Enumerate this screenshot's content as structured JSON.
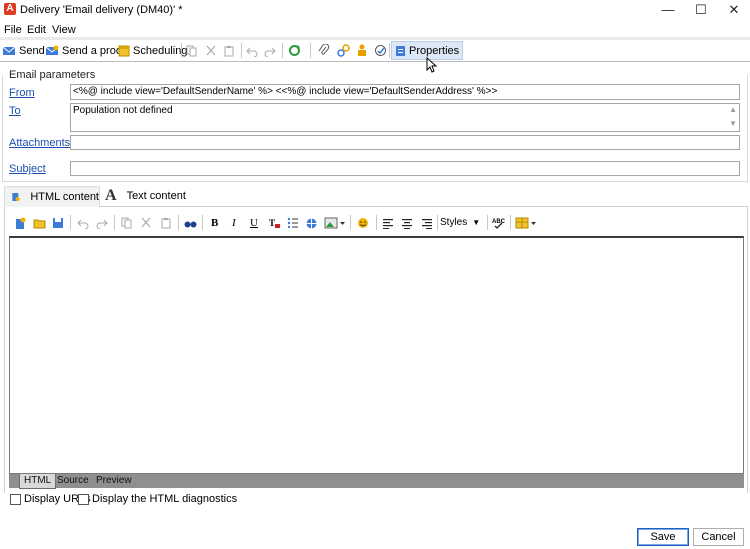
{
  "window": {
    "title": "Delivery 'Email delivery (DM40)' *",
    "controls": {
      "minimize": "—",
      "maximize": "☐",
      "close": "✕"
    }
  },
  "menu": [
    "File",
    "Edit",
    "View"
  ],
  "toolbar": {
    "send_label": "Send",
    "send_proof_label": "Send a proof",
    "scheduling_label": "Scheduling",
    "properties_label": "Properties"
  },
  "email_params": {
    "group_title": "Email parameters",
    "from_label": "From",
    "from_value": "<%@ include view='DefaultSenderName' %> <<%@ include view='DefaultSenderAddress' %>>",
    "to_label": "To",
    "to_value": "Population not defined",
    "attachments_label": "Attachments",
    "attachments_value": "",
    "subject_label": "Subject",
    "subject_value": ""
  },
  "content_tabs": {
    "html_label": "HTML content",
    "text_label": "Text content"
  },
  "editor_toolbar": {
    "styles_label": "Styles"
  },
  "editor_modes": [
    "HTML",
    "Source",
    "Preview"
  ],
  "options": {
    "display_urls_label": "Display URLs",
    "html_diagnostics_label": "Display the HTML diagnostics"
  },
  "buttons": {
    "save_label": "Save",
    "cancel_label": "Cancel"
  },
  "colors": {
    "link": "#1a4fb0",
    "app_icon": "#e03a20",
    "active_toolbar": "#dde8f7"
  }
}
